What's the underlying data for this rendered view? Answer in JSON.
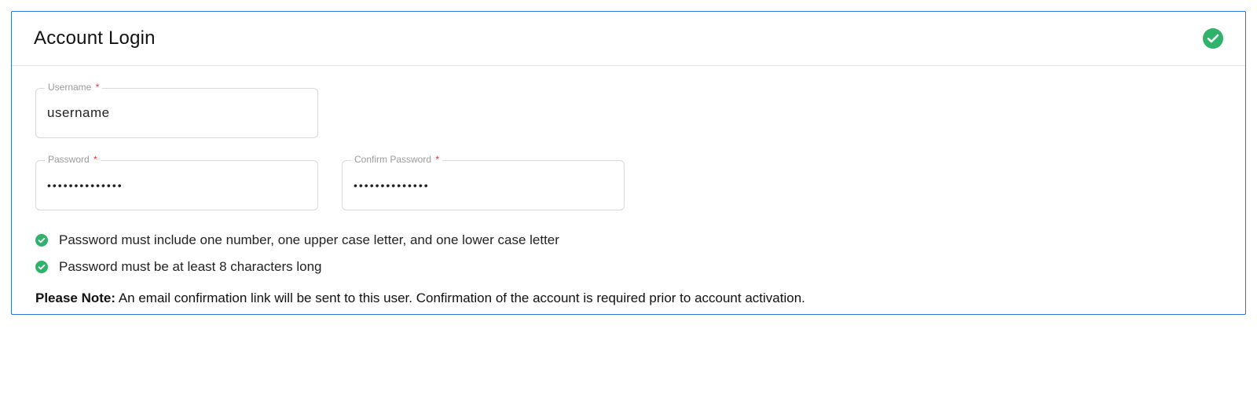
{
  "panel": {
    "title": "Account Login"
  },
  "fields": {
    "username": {
      "label": "Username",
      "value": "username",
      "required_symbol": "*"
    },
    "password": {
      "label": "Password",
      "value": "••••••••••••••",
      "required_symbol": "*"
    },
    "confirm": {
      "label": "Confirm Password",
      "value": "••••••••••••••",
      "required_symbol": "*"
    }
  },
  "rules": {
    "rule1": "Password must include one number, one upper case letter, and one lower case letter",
    "rule2": "Password must be at least 8 characters long"
  },
  "note": {
    "label": "Please Note:",
    "text": " An email confirmation link will be sent to this user. Confirmation of the account is required prior to account activation."
  },
  "colors": {
    "accent_green": "#2fb36a"
  }
}
